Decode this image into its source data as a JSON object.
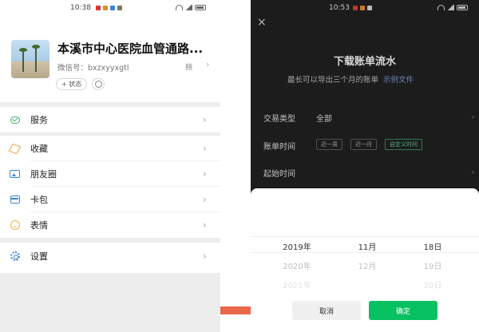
{
  "left_phone": {
    "status": {
      "time": "10:38"
    },
    "profile": {
      "name": "本溪市中心医院血管通路...",
      "wechat_id": "微信号：bxzxyyxgtl",
      "qr_code": "囍",
      "status_pill": "+ 状态"
    },
    "menu": [
      {
        "label": "服务",
        "icon": "service-icon"
      },
      {
        "label": "收藏",
        "icon": "favorites-icon"
      },
      {
        "label": "朋友圈",
        "icon": "moments-icon"
      },
      {
        "label": "卡包",
        "icon": "wallet-icon"
      },
      {
        "label": "表情",
        "icon": "emoji-icon"
      },
      {
        "label": "设置",
        "icon": "settings-icon"
      }
    ],
    "chevron": "›",
    "colors": {
      "accent_green": "#3bb26c",
      "accent_blue": "#3b86d4",
      "accent_orange": "#e3a23b"
    }
  },
  "right_phone": {
    "status": {
      "time": "10:53"
    },
    "close": "×",
    "title": "下载账单流水",
    "subtitle": "最长可以导出三个月的账单",
    "sample_link": "示例文件",
    "fields": {
      "type_label": "交易类型",
      "type_value": "全部",
      "time_label": "账单时间",
      "time_chips": [
        "近一周",
        "近一月",
        "自定义时间"
      ],
      "start_label": "起始时间"
    },
    "picker": {
      "years": [
        "2019年",
        "2020年",
        "2021年"
      ],
      "months": [
        "11月",
        "12月",
        ""
      ],
      "days": [
        "18日",
        "19日",
        "20日"
      ]
    },
    "cancel_label": "取消",
    "confirm_label": "确定",
    "colors": {
      "confirm_green": "#07c160",
      "link": "#6e86b8"
    }
  }
}
